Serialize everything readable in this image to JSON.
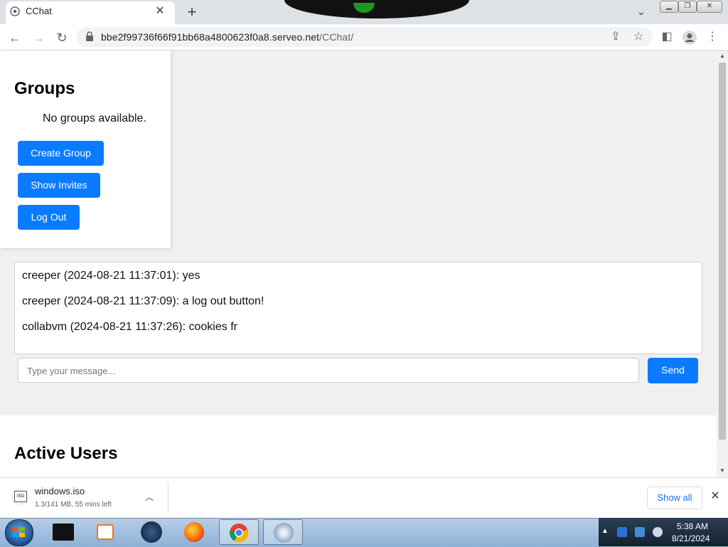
{
  "browser": {
    "tab_title": "CChat",
    "tab_close": "✕",
    "new_tab": "+",
    "url_host": "bbe2f99736f66f91bb68a4800623f0a8.serveo.net",
    "url_path": "/CChat/"
  },
  "sidebar": {
    "heading": "Groups",
    "empty_text": "No groups available.",
    "buttons": {
      "create_group": "Create Group",
      "show_invites": "Show Invites",
      "log_out": "Log Out"
    }
  },
  "chat": {
    "messages": [
      "creeper (2024-08-21 11:37:01): yes",
      "creeper (2024-08-21 11:37:09): a log out button!",
      "collabvm (2024-08-21 11:37:26): cookies fr"
    ],
    "input_placeholder": "Type your message...",
    "send_label": "Send"
  },
  "active_users": {
    "heading": "Active Users"
  },
  "download": {
    "file_name": "windows.iso",
    "icon_label": "ISO",
    "status": "1.3/141 MB, 55 mins left",
    "show_all": "Show all"
  },
  "taskbar": {
    "time": "5:38 AM",
    "date": "8/21/2024"
  },
  "colors": {
    "accent_button": "#0a7bff",
    "page_background": "#f0f0f0"
  }
}
